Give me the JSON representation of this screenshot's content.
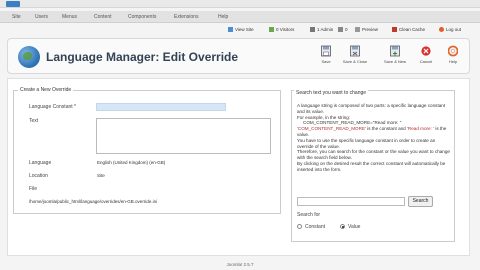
{
  "menu": {
    "items": [
      "Site",
      "Users",
      "Menus",
      "Content",
      "Components",
      "Extensions",
      "Help"
    ]
  },
  "status": {
    "view_site": "View Site",
    "visitors": "0 Visitors",
    "admin": "1 Admin",
    "messages": "0",
    "preview": "Preview",
    "clean_cache": "Clean Cache",
    "logout": "Log out"
  },
  "header": {
    "title": "Language Manager: Edit Override"
  },
  "toolbar": {
    "save": "Save",
    "save_close": "Save & Close",
    "save_new": "Save & New",
    "cancel": "Cancel",
    "help": "Help"
  },
  "form": {
    "legend": "Create a New Override",
    "constant_label": "Language Constant *",
    "constant_value": "",
    "text_label": "Text",
    "text_value": "",
    "language_label": "Language",
    "language_value": "English (United Kingdom) (en-GB)",
    "location_label": "Location",
    "location_value": "Site",
    "file_label": "File",
    "file_value": "/home/joomla/public_html/language/overrides/en-GB.override.ini"
  },
  "search_panel": {
    "legend": "Search text you want to change",
    "desc1": "A language string is composed of two parts: a specific language constant and its value.",
    "desc2": "For example, in the string:",
    "desc3": "COM_CONTENT_READ_MORE=\"Read more: \"",
    "desc4a": "'COM_CONTENT_READ_MORE'",
    "desc4b": " is the constant and ",
    "desc4c": "'Read more: '",
    "desc4d": " is the value.",
    "desc5": "You have to use the specific language constant in order to create an override of the value.",
    "desc6": "Therefore, you can search for the constant or the value you want to change with the search field below.",
    "desc7": "By clicking on the desired result the correct constant will automatically be inserted into the form.",
    "search_button": "Search",
    "search_value": "",
    "search_for_label": "Search for",
    "option_constant": "Constant",
    "option_value": "Value"
  },
  "footer": {
    "version": "Joomla! 2.5.7"
  }
}
